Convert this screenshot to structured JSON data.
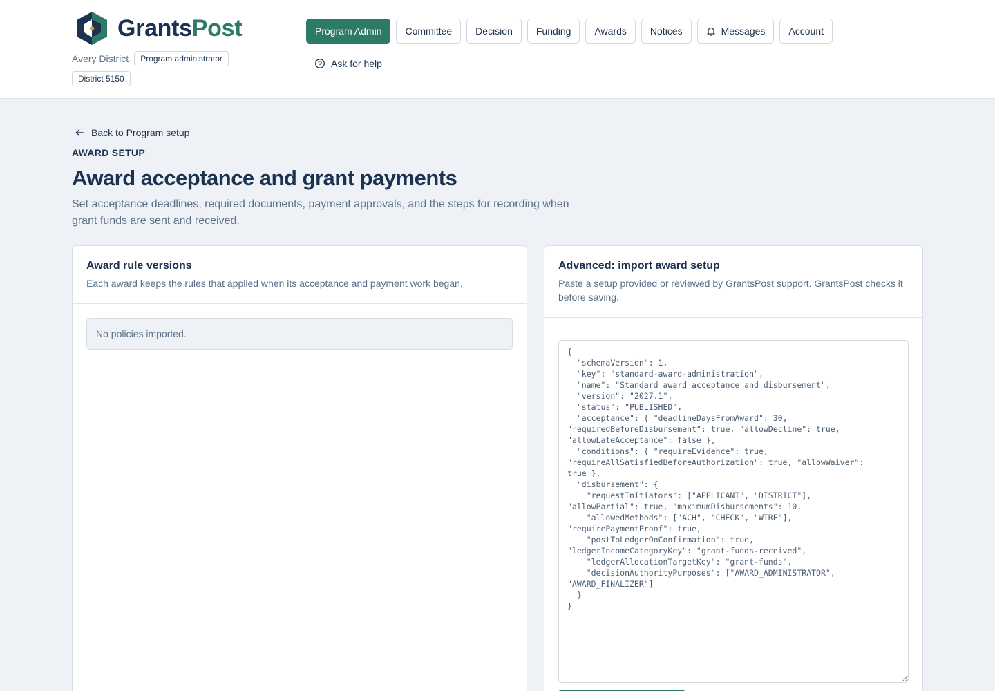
{
  "brand": {
    "name_part1": "Grants",
    "name_part2": "Post",
    "accent": "#2d7a67",
    "navy": "#1b3350",
    "gold": "#c9a45c"
  },
  "tenant": {
    "name": "Avery District",
    "role": "Program administrator",
    "district": "District 5150"
  },
  "nav": {
    "items": [
      {
        "label": "Program Admin",
        "active": true
      },
      {
        "label": "Committee"
      },
      {
        "label": "Decision"
      },
      {
        "label": "Funding"
      },
      {
        "label": "Awards"
      },
      {
        "label": "Notices"
      },
      {
        "label": "Messages",
        "icon": "bell-icon"
      },
      {
        "label": "Account"
      }
    ],
    "help_label": "Ask for help"
  },
  "page": {
    "back_label": "Back to Program setup",
    "eyebrow": "AWARD SETUP",
    "title": "Award acceptance and grant payments",
    "description": "Set acceptance deadlines, required documents, payment approvals, and the steps for recording when grant funds are sent and received."
  },
  "versions": {
    "title": "Award rule versions",
    "subtitle": "Each award keeps the rules that applied when its acceptance and payment work began.",
    "empty": "No policies imported."
  },
  "import": {
    "title": "Advanced: import award setup",
    "subtitle": "Paste a setup provided or reviewed by GrantsPost support. GrantsPost checks it before saving.",
    "json": "{\n  \"schemaVersion\": 1,\n  \"key\": \"standard-award-administration\",\n  \"name\": \"Standard award acceptance and disbursement\",\n  \"version\": \"2027.1\",\n  \"status\": \"PUBLISHED\",\n  \"acceptance\": { \"deadlineDaysFromAward\": 30,\n\"requiredBeforeDisbursement\": true, \"allowDecline\": true,\n\"allowLateAcceptance\": false },\n  \"conditions\": { \"requireEvidence\": true,\n\"requireAllSatisfiedBeforeAuthorization\": true, \"allowWaiver\":\ntrue },\n  \"disbursement\": {\n    \"requestInitiators\": [\"APPLICANT\", \"DISTRICT\"],\n\"allowPartial\": true, \"maximumDisbursements\": 10,\n    \"allowedMethods\": [\"ACH\", \"CHECK\", \"WIRE\"],\n\"requirePaymentProof\": true,\n    \"postToLedgerOnConfirmation\": true,\n\"ledgerIncomeCategoryKey\": \"grant-funds-received\",\n    \"ledgerAllocationTargetKey\": \"grant-funds\",\n    \"decisionAuthorityPurposes\": [\"AWARD_ADMINISTRATOR\",\n\"AWARD_FINALIZER\"]\n  }\n}"
  }
}
